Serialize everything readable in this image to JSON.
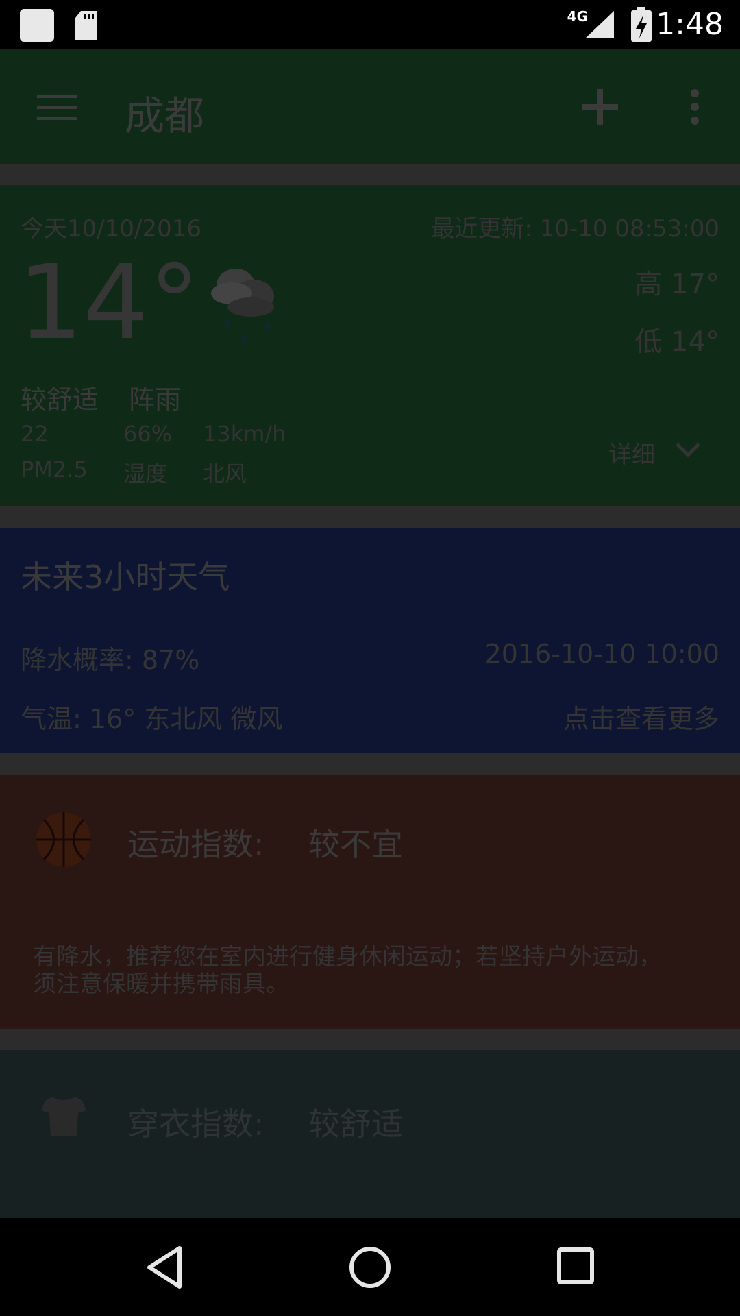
{
  "status_bar": {
    "time": "1:48",
    "network": "4G"
  },
  "toolbar": {
    "title": "成都"
  },
  "today": {
    "date": "今天10/10/2016",
    "updated": "最近更新: 10-10 08:53:00",
    "temp": "14°",
    "high": "高 17°",
    "low": "低 14°",
    "comfort": "较舒适",
    "condition": "阵雨",
    "pm25_value": "22",
    "pm25_label": "PM2.5",
    "humidity_value": "66%",
    "humidity_label": "湿度",
    "wind_value": "13km/h",
    "wind_label": "北风",
    "detail_label": "详细"
  },
  "next3h": {
    "title": "未来3小时天气",
    "precip": "降水概率: 87%",
    "datetime": "2016-10-10 10:00",
    "temp_wind": "气温: 16°   东北风 微风",
    "more": "点击查看更多"
  },
  "sport": {
    "label": "运动指数:",
    "value": "较不宜",
    "desc_line1": "有降水，推荐您在室内进行健身休闲运动；若坚持户外运动，",
    "desc_line2": "须注意保暖并携带雨具。"
  },
  "cloth": {
    "label": "穿衣指数:",
    "value": "较舒适"
  },
  "colors": {
    "today_bg": "#0f2a17",
    "next_bg": "#0e1533",
    "sport_bg": "#2a1613",
    "cloth_bg": "#182122"
  }
}
